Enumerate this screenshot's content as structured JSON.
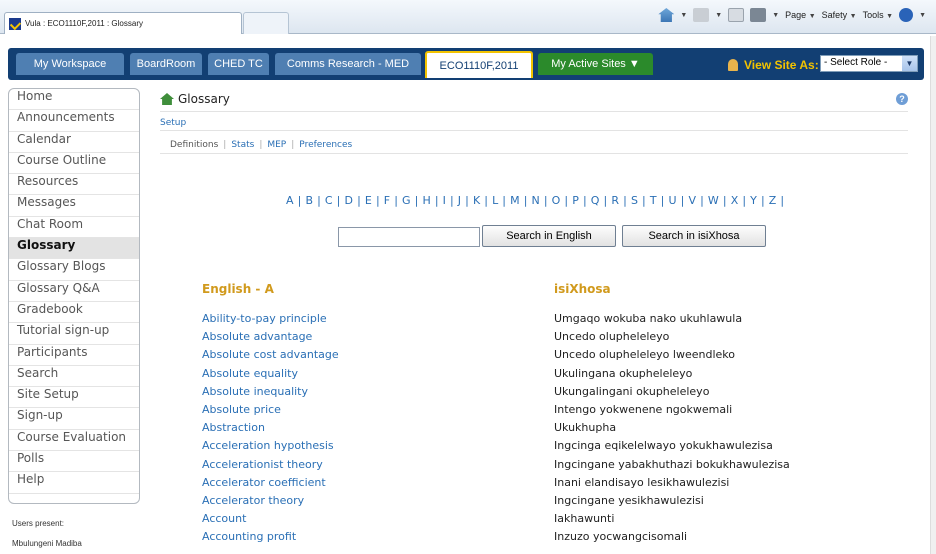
{
  "browser": {
    "tab_title": "Vula : ECO1110F,2011 : Glossary",
    "commands": {
      "page": "Page",
      "safety": "Safety",
      "tools": "Tools"
    }
  },
  "site_tabs": [
    {
      "label": "My Workspace"
    },
    {
      "label": "BoardRoom"
    },
    {
      "label": "CHED TC"
    },
    {
      "label": "Comms Research - MED"
    },
    {
      "label": "ECO1110F,2011"
    },
    {
      "label": "My Active Sites"
    }
  ],
  "view_site_as": {
    "label": "View Site As:",
    "select_value": "- Select Role -"
  },
  "tool_menu": [
    "Home",
    "Announcements",
    "Calendar",
    "Course Outline",
    "Resources",
    "Messages",
    "Chat Room",
    "Glossary",
    "Glossary Blogs",
    "Glossary Q&A",
    "Gradebook",
    "Tutorial sign-up",
    "Participants",
    "Search",
    "Site Setup",
    "Sign-up",
    "Course Evaluation",
    "Polls",
    "Help"
  ],
  "users_present": {
    "label": "Users present:",
    "names": [
      "Mbulungeni Madiba"
    ]
  },
  "page": {
    "title": "Glossary",
    "setup": "Setup",
    "subnav": [
      "Definitions",
      "Stats",
      "MEP",
      "Preferences"
    ],
    "alphabet": [
      "A",
      "B",
      "C",
      "D",
      "E",
      "F",
      "G",
      "H",
      "I",
      "J",
      "K",
      "L",
      "M",
      "N",
      "O",
      "P",
      "Q",
      "R",
      "S",
      "T",
      "U",
      "V",
      "W",
      "X",
      "Y",
      "Z"
    ],
    "search": {
      "value": "",
      "btn_english": "Search in English",
      "btn_xhosa": "Search in isiXhosa"
    },
    "col_english": "English - A",
    "col_xhosa": "isiXhosa",
    "terms": [
      {
        "en": "Ability-to-pay principle",
        "xh": "Umgaqo wokuba nako ukuhlawula"
      },
      {
        "en": "Absolute advantage",
        "xh": "Uncedo olupheleleyo"
      },
      {
        "en": "Absolute cost advantage",
        "xh": "Uncedo olupheleleyo lweendleko"
      },
      {
        "en": "Absolute equality",
        "xh": "Ukulingana okupheleleyo"
      },
      {
        "en": "Absolute inequality",
        "xh": "Ukungalingani okupheleleyo"
      },
      {
        "en": "Absolute price",
        "xh": "Intengo yokwenene ngokwemali"
      },
      {
        "en": "Abstraction",
        "xh": "Ukukhupha"
      },
      {
        "en": "Acceleration hypothesis",
        "xh": "Ingcinga eqikelelwayo yokukhawulezisa"
      },
      {
        "en": "Accelerationist theory",
        "xh": "Ingcingane yabakhuthazi bokukhawulezisa"
      },
      {
        "en": "Accelerator coefficient",
        "xh": "Inani elandisayo lesikhawulezisi"
      },
      {
        "en": "Accelerator theory",
        "xh": "Ingcingane yesikhawulezisi"
      },
      {
        "en": "Account",
        "xh": "Iakhawunti"
      },
      {
        "en": "Accounting profit",
        "xh": "Inzuzo yocwangcisomali"
      }
    ]
  }
}
